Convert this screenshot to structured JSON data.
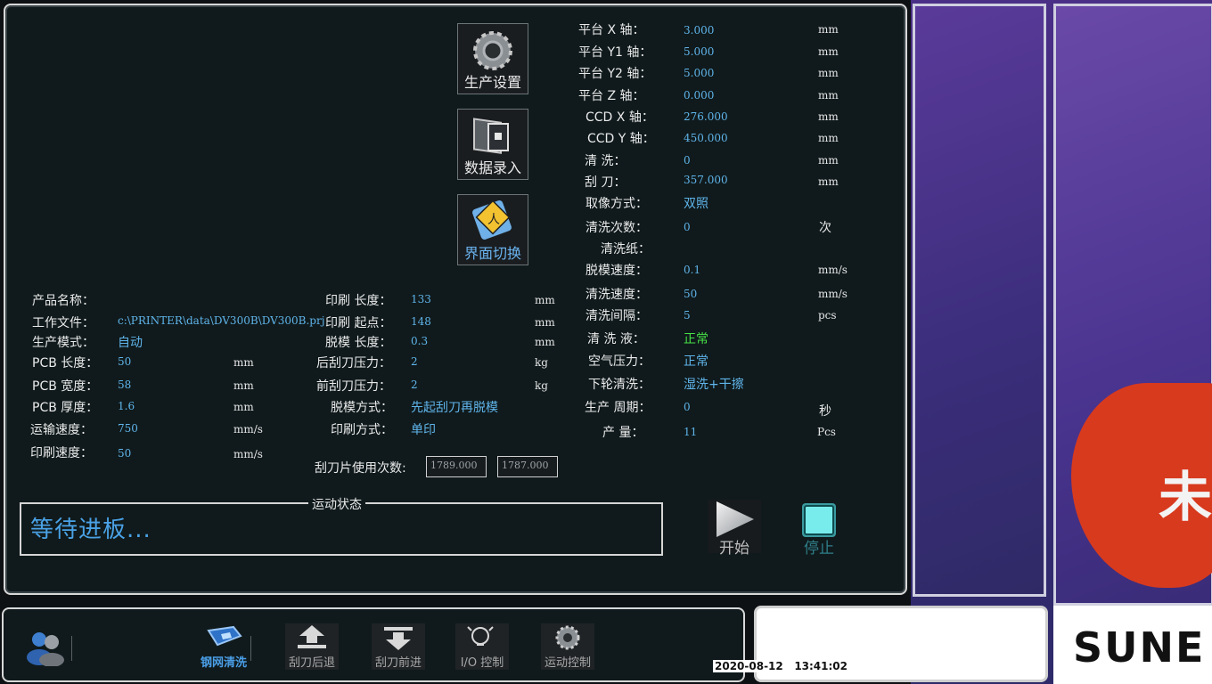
{
  "side_buttons": {
    "production_settings": "生产设置",
    "data_entry": "数据录入",
    "interface_switch": "界面切换"
  },
  "product": {
    "name_label": "产品名称：",
    "name_value": "",
    "file_label": "工作文件：",
    "file_value": "c:\\PRINTER\\data\\DV300B\\DV300B.prj",
    "mode_label": "生产模式：",
    "mode_value": "自动",
    "pcb_length_label": "PCB  长度：",
    "pcb_length_value": "50",
    "pcb_length_unit": "mm",
    "pcb_width_label": "PCB  宽度：",
    "pcb_width_value": "58",
    "pcb_width_unit": "mm",
    "pcb_thickness_label": "PCB  厚度：",
    "pcb_thickness_value": "1.6",
    "pcb_thickness_unit": "mm",
    "transport_speed_label": "运输速度：",
    "transport_speed_value": "750",
    "transport_speed_unit": "mm/s",
    "print_speed_label": "印刷速度：",
    "print_speed_value": "50",
    "print_speed_unit": "mm/s"
  },
  "print": {
    "length_label": "印刷  长度：",
    "length_value": "133",
    "length_unit": "mm",
    "start_label": "印刷  起点：",
    "start_value": "148",
    "start_unit": "mm",
    "demold_length_label": "脱模  长度：",
    "demold_length_value": "0.3",
    "demold_length_unit": "mm",
    "rear_pressure_label": "后刮刀压力：",
    "rear_pressure_value": "2",
    "rear_pressure_unit": "kg",
    "front_pressure_label": "前刮刀压力：",
    "front_pressure_value": "2",
    "front_pressure_unit": "kg",
    "demold_mode_label": "脱模方式：",
    "demold_mode_value": "先起刮刀再脱模",
    "print_mode_label": "印刷方式：",
    "print_mode_value": "单印",
    "blade_count_label": "刮刀片使用次数:",
    "blade_count_a": "1789.000",
    "blade_count_b": "1787.000"
  },
  "axes": {
    "x_label": "平台 X 轴：",
    "x_value": "3.000",
    "y1_label": "平台 Y1 轴：",
    "y1_value": "5.000",
    "y2_label": "平台 Y2 轴：",
    "y2_value": "5.000",
    "z_label": "平台 Z 轴：",
    "z_value": "0.000",
    "ccdx_label": "CCD X 轴：",
    "ccdx_value": "276.000",
    "ccdy_label": "CCD Y 轴：",
    "ccdy_value": "450.000",
    "clean_label": "清      洗：",
    "clean_value": "0",
    "blade_label": "刮      刀：",
    "blade_value": "357.000",
    "unit": "mm"
  },
  "status": {
    "capture_label": "取像方式：",
    "capture_value": "双照",
    "clean_count_label": "清洗次数：",
    "clean_count_value": "0",
    "clean_count_unit": "次",
    "clean_paper_label": "清洗纸：",
    "clean_paper_value": "",
    "demold_speed_label": "脱模速度：",
    "demold_speed_value": "0.1",
    "demold_speed_unit": "mm/s",
    "clean_speed_label": "清洗速度：",
    "clean_speed_value": "50",
    "clean_speed_unit": "mm/s",
    "clean_interval_label": "清洗间隔：",
    "clean_interval_value": "5",
    "clean_interval_unit": "pcs",
    "clean_fluid_label": "清  洗  液：",
    "clean_fluid_value": "正常",
    "air_pressure_label": "空气压力：",
    "air_pressure_value": "正常",
    "lower_clean_label": "下轮清洗：",
    "lower_clean_value": "湿洗+干擦",
    "cycle_label": "生产  周期：",
    "cycle_value": "0",
    "cycle_unit": "秒",
    "output_label": "产      量：",
    "output_value": "11",
    "output_unit": "Pcs"
  },
  "motion": {
    "legend": "运动状态",
    "text": "等待进板..."
  },
  "controls": {
    "start": "开始",
    "stop": "停止"
  },
  "toolbar": {
    "stencil_clean": "钢网清洗",
    "blade_back": "刮刀后退",
    "blade_forward": "刮刀前进",
    "io_control": "I/O 控制",
    "motion_control": "运动控制"
  },
  "footer": {
    "date": "2020-08-12",
    "time": "13:41:02",
    "brand": "SUNE"
  },
  "colors": {
    "value_blue": "#5fb4ea",
    "ok_green": "#46e046",
    "panel_bg": "#101a1c"
  }
}
